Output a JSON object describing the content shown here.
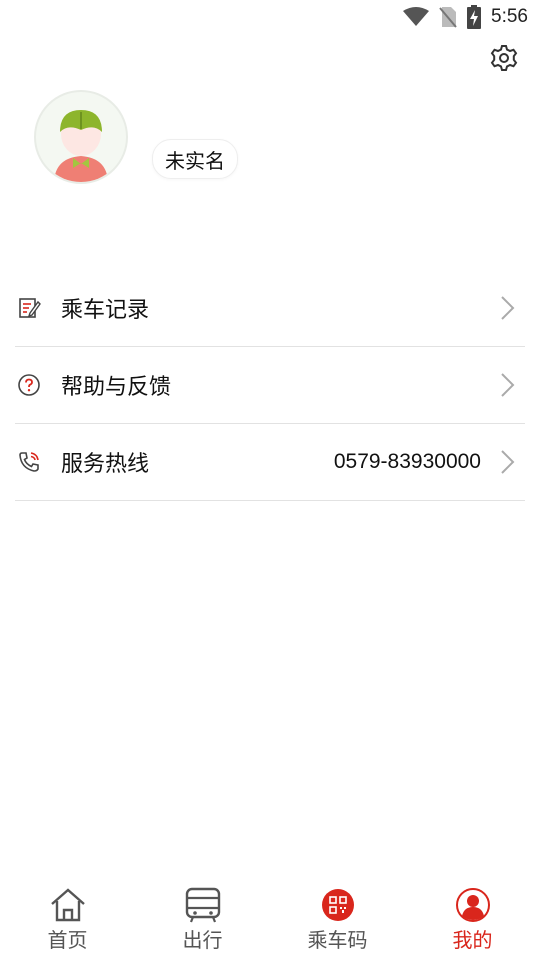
{
  "status_bar": {
    "time": "5:56"
  },
  "profile": {
    "name_status": "未实名"
  },
  "menu": [
    {
      "label": "乘车记录",
      "value": ""
    },
    {
      "label": "帮助与反馈",
      "value": ""
    },
    {
      "label": "服务热线",
      "value": "0579-83930000"
    }
  ],
  "tabs": [
    {
      "label": "首页",
      "icon": "home-icon"
    },
    {
      "label": "出行",
      "icon": "bus-icon"
    },
    {
      "label": "乘车码",
      "icon": "qr-code-icon"
    },
    {
      "label": "我的",
      "icon": "user-icon"
    }
  ],
  "colors": {
    "accent": "#d9261c",
    "divider": "#e2e2e2"
  }
}
